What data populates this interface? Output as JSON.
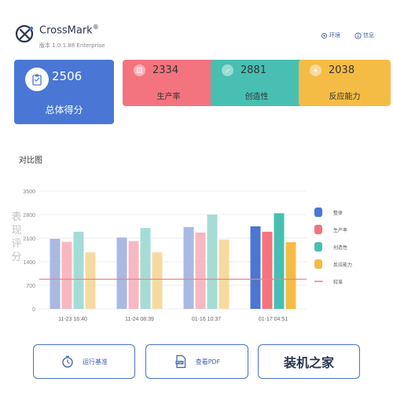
{
  "header": {
    "app_name": "CrossMark",
    "registered": "®",
    "version": "版本 1.0.1.88 Enterprise",
    "env_link": "环境",
    "info_link": "信息"
  },
  "cards": {
    "overall": {
      "value": "2506",
      "label": "总体得分",
      "color": "#4a77d5"
    },
    "productivity": {
      "value": "2334",
      "label": "生产率",
      "color": "#f3747e"
    },
    "creativity": {
      "value": "2881",
      "label": "创造性",
      "color": "#48bfb2"
    },
    "responsiveness": {
      "value": "2038",
      "label": "反应能力",
      "color": "#f5bc45"
    }
  },
  "section": {
    "title": "对比图"
  },
  "buttons": {
    "run_benchmark": "运行基准",
    "view_pdf": "查看PDF",
    "third": "装机之家"
  },
  "chart_data": {
    "type": "bar",
    "ylabel": "表现评分",
    "ylim": [
      0,
      3500
    ],
    "yticks": [
      0,
      700,
      1400,
      2100,
      2800,
      3500
    ],
    "categories": [
      "11-23 16:40",
      "11-24 08:39",
      "01-16 10:37",
      "01-17 04:51"
    ],
    "highlight_category_index": 3,
    "series": [
      {
        "name": "整体",
        "color": "#4a77d5",
        "faded_color": "#a9b9e2",
        "values": [
          2080,
          2120,
          2430,
          2450
        ]
      },
      {
        "name": "生产率",
        "color": "#f3747e",
        "faded_color": "#f8b8c2",
        "values": [
          1990,
          2010,
          2270,
          2290
        ]
      },
      {
        "name": "创造性",
        "color": "#48bfb2",
        "faded_color": "#a6dcd6",
        "values": [
          2290,
          2400,
          2800,
          2840
        ]
      },
      {
        "name": "反应能力",
        "color": "#f5bc45",
        "faded_color": "#f7daa0",
        "values": [
          1680,
          1680,
          2060,
          1980
        ]
      }
    ],
    "baseline": {
      "name": "较准",
      "color": "#f08080",
      "value": 880
    },
    "grid": true,
    "legend_position": "right"
  }
}
